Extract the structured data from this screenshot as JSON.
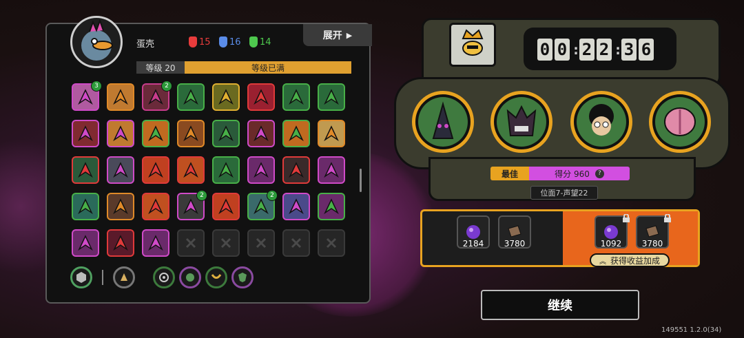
{
  "player": {
    "name": "蛋壳",
    "level_label": "等级 20",
    "level_status": "等级已满",
    "expand_label": "展开"
  },
  "stats": [
    {
      "icon": "red-mask-icon",
      "value": "15",
      "color": "#e83c3c"
    },
    {
      "icon": "blue-mask-icon",
      "value": "16",
      "color": "#5a8ce8"
    },
    {
      "icon": "green-mask-icon",
      "value": "14",
      "color": "#4ec84e"
    }
  ],
  "skills": [
    {
      "icon": "pink-ribbon-icon",
      "color": "#d04ac8",
      "bg": "#b05aa0",
      "badge": "3"
    },
    {
      "icon": "spikes-icon",
      "color": "#e08a28",
      "bg": "#c07a30",
      "badge": ""
    },
    {
      "icon": "daggers-icon",
      "color": "#c83c8c",
      "bg": "#6a2a3a",
      "badge": "2"
    },
    {
      "icon": "arrow-icon",
      "color": "#48b048",
      "bg": "#2a6a3a",
      "badge": ""
    },
    {
      "icon": "sun-burst-icon",
      "color": "#e0b030",
      "bg": "#6a6a20",
      "badge": ""
    },
    {
      "icon": "slash-icon",
      "color": "#e03a3a",
      "bg": "#9a2030",
      "badge": ""
    },
    {
      "icon": "diamond-icon",
      "color": "#48b048",
      "bg": "#2a6a3a",
      "badge": ""
    },
    {
      "icon": "swirl-icon",
      "color": "#48b048",
      "bg": "#2a6a3a",
      "badge": ""
    },
    {
      "icon": "lightning-icon",
      "color": "#d04ac8",
      "bg": "#802a30",
      "badge": ""
    },
    {
      "icon": "paw-icon",
      "color": "#d04ac8",
      "bg": "#c07a30",
      "badge": ""
    },
    {
      "icon": "claw-icon",
      "color": "#48b048",
      "bg": "#c06a20",
      "badge": ""
    },
    {
      "icon": "gear-icon",
      "color": "#e08a28",
      "bg": "#8a4a20",
      "badge": ""
    },
    {
      "icon": "star-burst-icon",
      "color": "#48b048",
      "bg": "#2a5a3a",
      "badge": ""
    },
    {
      "icon": "fist-icon",
      "color": "#d04ac8",
      "bg": "#6a2a2a",
      "badge": ""
    },
    {
      "icon": "gate-icon",
      "color": "#48b048",
      "bg": "#c06a20",
      "badge": ""
    },
    {
      "icon": "sunrise-icon",
      "color": "#e08a28",
      "bg": "#c09a50",
      "badge": ""
    },
    {
      "icon": "heart-icon",
      "color": "#e03a3a",
      "bg": "#2a5a3a",
      "badge": ""
    },
    {
      "icon": "compass-icon",
      "color": "#d04ac8",
      "bg": "#4a4a5a",
      "badge": ""
    },
    {
      "icon": "target-icon",
      "color": "#e03a3a",
      "bg": "#c04020",
      "badge": ""
    },
    {
      "icon": "fire-icon",
      "color": "#e03a3a",
      "bg": "#c05020",
      "badge": ""
    },
    {
      "icon": "grass-icon",
      "color": "#48b048",
      "bg": "#2a6a3a",
      "badge": ""
    },
    {
      "icon": "arrows-icon",
      "color": "#d04ac8",
      "bg": "#6a2a6a",
      "badge": ""
    },
    {
      "icon": "beast-icon",
      "color": "#e03a3a",
      "bg": "#3a2a2a",
      "badge": ""
    },
    {
      "icon": "feather-icon",
      "color": "#d04ac8",
      "bg": "#6a2a6a",
      "badge": ""
    },
    {
      "icon": "dash-icon",
      "color": "#48b048",
      "bg": "#2a6a5a",
      "badge": ""
    },
    {
      "icon": "chain-icon",
      "color": "#e08a28",
      "bg": "#5a3a2a",
      "badge": ""
    },
    {
      "icon": "flame-icon",
      "color": "#e03a3a",
      "bg": "#c05020",
      "badge": ""
    },
    {
      "icon": "shield-icon",
      "color": "#d04ac8",
      "bg": "#3a3a3a",
      "badge": "2"
    },
    {
      "icon": "fire-ring-icon",
      "color": "#e03a3a",
      "bg": "#c04020",
      "badge": ""
    },
    {
      "icon": "spear-icon",
      "color": "#48b048",
      "bg": "#3a6a6a",
      "badge": "2"
    },
    {
      "icon": "bomb-icon",
      "color": "#d04ac8",
      "bg": "#4a4a8a",
      "badge": ""
    },
    {
      "icon": "up-arrow-icon",
      "color": "#48b048",
      "bg": "#6a2a6a",
      "badge": ""
    },
    {
      "icon": "net-icon",
      "color": "#d04ac8",
      "bg": "#6a2a6a",
      "badge": ""
    },
    {
      "icon": "maw-icon",
      "color": "#e03a3a",
      "bg": "#5a1a2a",
      "badge": ""
    },
    {
      "icon": "claw-slash-icon",
      "color": "#d04ac8",
      "bg": "#6a2a6a",
      "badge": ""
    },
    {
      "icon": "empty-slot-icon",
      "color": "#3a3a3a",
      "bg": "#262626",
      "badge": ""
    },
    {
      "icon": "empty-slot-icon",
      "color": "#3a3a3a",
      "bg": "#262626",
      "badge": ""
    },
    {
      "icon": "empty-slot-icon",
      "color": "#3a3a3a",
      "bg": "#262626",
      "badge": ""
    },
    {
      "icon": "empty-slot-icon",
      "color": "#3a3a3a",
      "bg": "#262626",
      "badge": ""
    },
    {
      "icon": "empty-slot-icon",
      "color": "#3a3a3a",
      "bg": "#262626",
      "badge": ""
    }
  ],
  "bottom_icons": [
    "hexagon-icon",
    "hands-icon",
    "eye-icon",
    "swirl-icon",
    "wings-icon",
    "shield-icon"
  ],
  "timer": {
    "d1": "0",
    "d2": "0",
    "d3": "2",
    "d4": "2",
    "d5": "3",
    "d6": "6",
    "sep": ":"
  },
  "characters": [
    {
      "icon": "hooded-figure-icon",
      "bg": "#3f7a3f"
    },
    {
      "icon": "horned-beast-icon",
      "bg": "#3f7a3f"
    },
    {
      "icon": "curly-hair-face-icon",
      "bg": "#3f7a3f"
    },
    {
      "icon": "brain-icon",
      "bg": "#3f7a3f"
    }
  ],
  "score": {
    "best_label": "最佳",
    "score_label": "得分 960",
    "rank_label": "位面7-声望22"
  },
  "rewards": {
    "base": [
      {
        "icon": "purple-orb-icon",
        "value": "2184"
      },
      {
        "icon": "brown-cube-icon",
        "value": "3780"
      }
    ],
    "bonus": [
      {
        "icon": "purple-orb-icon",
        "value": "1092"
      },
      {
        "icon": "brown-cube-icon",
        "value": "3780"
      }
    ],
    "boost_label": "获得收益加成"
  },
  "continue_label": "继续",
  "version": "149551 1.2.0(34)"
}
